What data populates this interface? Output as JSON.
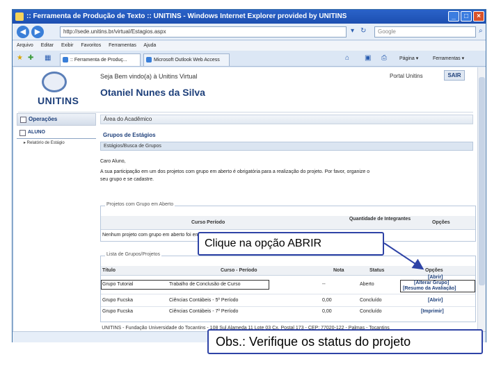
{
  "window": {
    "title": ":: Ferramenta de Produção de Texto :: UNITINS - Windows Internet Explorer provided by UNITINS",
    "url": "http://sede.unitins.br/virtual/Estagios.aspx",
    "search_placeholder": "Google",
    "menu": [
      "Arquivo",
      "Editar",
      "Exibir",
      "Favoritos",
      "Ferramentas",
      "Ajuda"
    ],
    "tabs": [
      ":: Ferramenta de Produç...",
      "Microsoft Outlook Web Access"
    ],
    "toolbar_right": [
      "Página ▾",
      "Ferramentas ▾"
    ]
  },
  "portal": {
    "logo_text": "UNITINS",
    "welcome": "Seja Bem vindo(a) à Unitins Virtual",
    "user_name": "Otaniel Nunes da Silva",
    "portal_link": "Portal Unitins",
    "sair": "SAIR"
  },
  "sidebar": {
    "section": "Operações",
    "item": "ALUNO",
    "sub_item": "▸ Relatório de Estágio"
  },
  "main": {
    "area_header": "Área do Acadêmico",
    "section_title": "Grupos de Estágios",
    "section_sub": "Estágios/Busca de Grupos",
    "message_greeting": "Caro Aluno,",
    "message_body1": "A sua participação em um dos projetos com grupo em aberto é obrigatória para a realização do projeto. Por favor, organize o",
    "message_body2": "seu grupo e se cadastre."
  },
  "open_groups": {
    "legend": "Projetos com Grupo em Aberto",
    "col_course": "Curso   Período",
    "col_members": "Quantidade de Integrantes",
    "col_options": "Opções",
    "empty_message": "Nenhum projeto com grupo em aberto foi encontrado."
  },
  "groups_list": {
    "legend": "Lista de Grupos/Projetos",
    "headers": [
      "Título",
      "Curso - Período",
      "Nota",
      "Status",
      "Opções"
    ],
    "rows": [
      {
        "title": "Grupo Tutorial",
        "course": "Trabalho de Conclusão de Curso",
        "grade": "--",
        "status": "Aberto",
        "options": [
          "[Abrir]",
          "[Alterar Grupo]",
          "[Resumo da Avaliação]"
        ]
      },
      {
        "title": "Grupo Fucska",
        "course": "Ciências Contábeis - 5º Período",
        "grade": "0,00",
        "status": "Concluído",
        "options": [
          "[Abrir]"
        ]
      },
      {
        "title": "Grupo Fucska",
        "course": "Ciências Contábeis - 7º Período",
        "grade": "0,00",
        "status": "Concluído",
        "options": [
          "[Imprimir]"
        ]
      }
    ]
  },
  "footer": "UNITINS - Fundação Universidade do Tocantins - 108 Sul Alameda 11 Lote 03 Cx. Postal 173 - CEP: 77020-122 - Palmas - Tocantins",
  "callouts": {
    "abrir": "Clique na opção ABRIR",
    "status": "Obs.: Verifique os status do projeto"
  },
  "colors": {
    "accent": "#2e43a6",
    "brand": "#1d3f7a",
    "titlebar": "#2a62c9"
  }
}
